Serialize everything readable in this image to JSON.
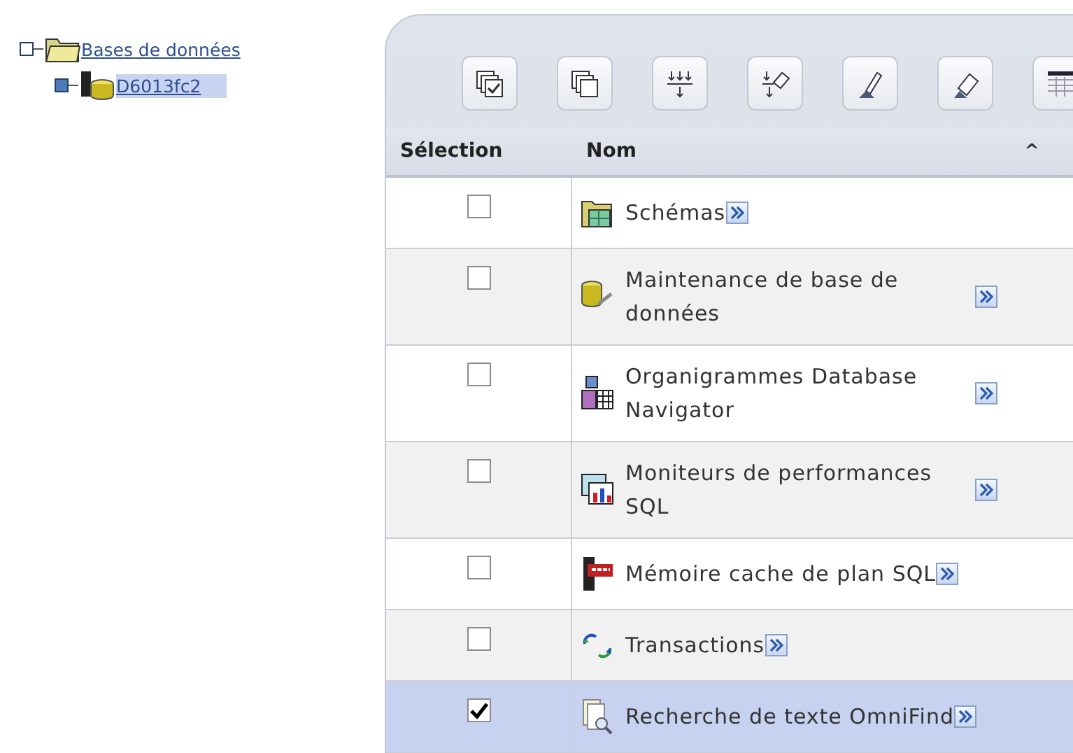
{
  "tree": {
    "items": [
      {
        "label": "Bases de données",
        "selected": false,
        "children": [
          {
            "label": "D6013fc2",
            "selected": true
          }
        ]
      }
    ]
  },
  "toolbar": {
    "buttons": [
      {
        "kind": "select-all"
      },
      {
        "kind": "deselect-all"
      },
      {
        "kind": "expand-filter"
      },
      {
        "kind": "clear-filter"
      },
      {
        "kind": "edit-sort"
      },
      {
        "kind": "clear-sort"
      },
      {
        "kind": "columns"
      }
    ]
  },
  "table": {
    "columns": [
      {
        "label": "Sélection"
      },
      {
        "label": "Nom",
        "sort": "^"
      }
    ],
    "rows": [
      {
        "name": "Schémas",
        "kind": "folder",
        "checked": false,
        "selected": false
      },
      {
        "name": "Maintenance de base de données",
        "kind": "maintenance",
        "checked": false,
        "selected": false
      },
      {
        "name": "Organigrammes Database Navigator",
        "kind": "diagram",
        "checked": false,
        "selected": false
      },
      {
        "name": "Moniteurs de performances SQL",
        "kind": "monitor",
        "checked": false,
        "selected": false
      },
      {
        "name": "Mémoire cache de plan SQL",
        "kind": "cache",
        "checked": false,
        "selected": false
      },
      {
        "name": "Transactions",
        "kind": "transaction",
        "checked": false,
        "selected": false
      },
      {
        "name": "Recherche de texte OmniFind",
        "kind": "search",
        "checked": true,
        "selected": true
      }
    ]
  }
}
